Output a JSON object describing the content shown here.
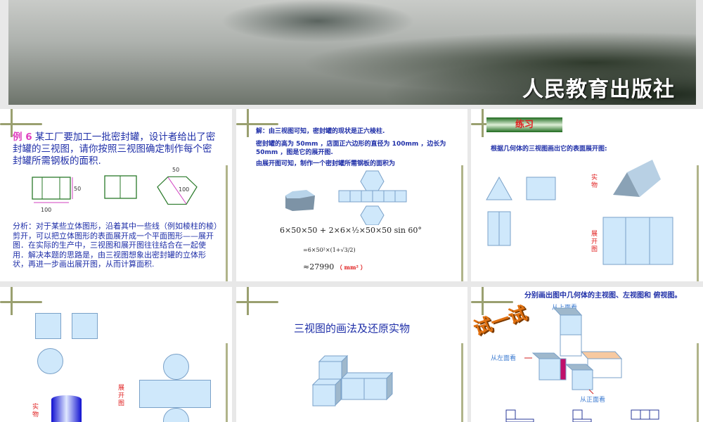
{
  "header": {
    "publisher": "人民教育出版社"
  },
  "slide1": {
    "example_label": "例 6",
    "problem": "某工厂要加工一批密封罐，设计者给出了密封罐的三视图，请你按照三视图确定制作每个密封罐所需钢板的面积.",
    "dim_width": "100",
    "dim_height": "50",
    "dim_side": "50",
    "dim_diag": "100",
    "analysis": "分析：对于某些立体图形，沿着其中一些线（例如棱柱的棱）剪开，可以把立体图形的表面展开成一个平面图形——展开图．在实际的生产中，三视图和展开图往往结合在一起使用．解决本题的思路是，由三视图想象出密封罐的立体形状，再进一步画出展开图，从而计算面积."
  },
  "slide2": {
    "line1": "解：由三视图可知，密封罐的现状是正六棱柱.",
    "line2": "密封罐的高为 50mm ，店面正六边形的直径为 100mm ，边长为 50mm ，图是它的展开图.",
    "line3": "由展开图可知，制作一个密封罐所需钢板的面积为",
    "formula1": "6×50×50 + 2×6×½×50×50 sin 60°",
    "formula2": "=6×50²×(1+√3/2)",
    "result": "≈27990",
    "unit": "（ mm² ）"
  },
  "slide3": {
    "banner": "练习",
    "instruction": "根据几何体的三视图画出它的表面展开图:",
    "label_object": "实物",
    "label_net": "展开图"
  },
  "slide4": {
    "label_object": "实物",
    "label_net": "展开图"
  },
  "slide5": {
    "title": "三视图的画法及还原实物"
  },
  "slide6": {
    "instruction": "分别画出图中几何体的主视图、左视图和 俯视图。",
    "try_logo": "试一试",
    "from_top": "从上面看",
    "from_left": "从左面看",
    "from_front": "从正面看"
  }
}
